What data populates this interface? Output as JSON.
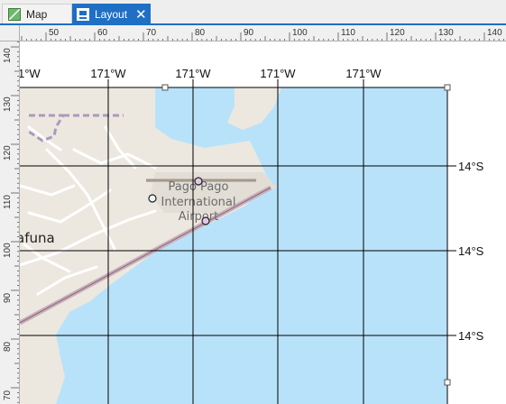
{
  "tabs": [
    {
      "label": "Map",
      "icon": "map-tab-icon",
      "active": false
    },
    {
      "label": "Layout",
      "icon": "layout-tab-icon",
      "active": true,
      "closable": true
    }
  ],
  "rulers": {
    "horizontal_labels": [
      "50",
      "60",
      "70",
      "80",
      "90",
      "100",
      "110",
      "120",
      "130",
      "140"
    ],
    "vertical_labels": [
      "140",
      "130",
      "120",
      "110",
      "100",
      "90",
      "80",
      "70"
    ]
  },
  "map_frame": {
    "top_graticule_labels": [
      "1°W",
      "171°W",
      "171°W",
      "171°W",
      "171°W"
    ],
    "right_graticule_labels": [
      "14°S",
      "14°S",
      "14°S"
    ],
    "place_labels": {
      "airport_line1": "Pago Pago",
      "airport_line2": "International",
      "airport_line3": "Airport",
      "town": "afuna"
    },
    "colors": {
      "water": "#b8e2fa",
      "land": "#ece8df",
      "roads": "#ffffff",
      "graticule": "#000000",
      "boundary": "#a99bbd",
      "selection_handle": "#ffffff"
    }
  }
}
